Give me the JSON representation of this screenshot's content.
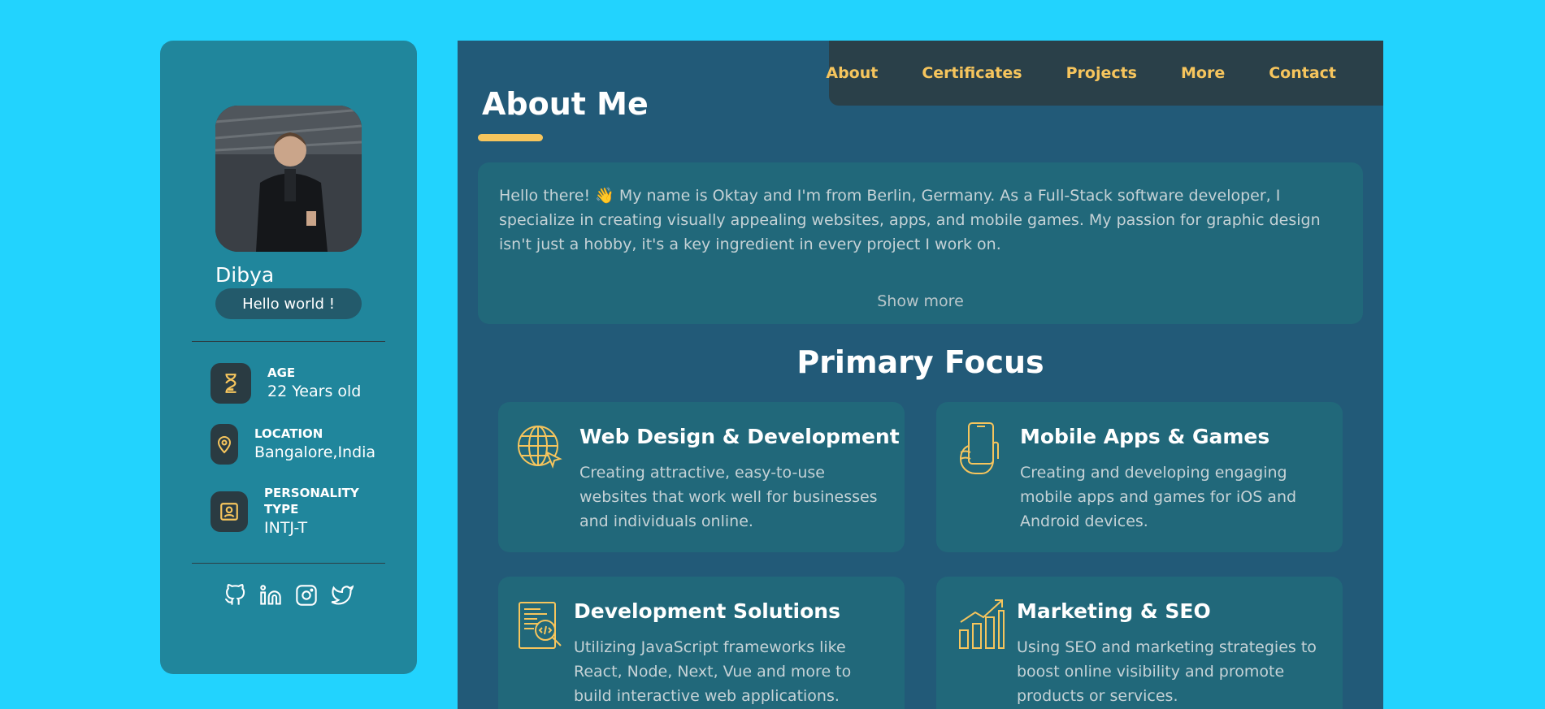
{
  "profile": {
    "name": "Dibya",
    "tagline": "Hello world !",
    "info": [
      {
        "label": "AGE",
        "value": "22 Years old",
        "icon": "hourglass-icon"
      },
      {
        "label": "LOCATION",
        "value": "Bangalore,India",
        "icon": "location-pin-icon"
      },
      {
        "label": "PERSONALITY TYPE",
        "value": "INTJ-T",
        "icon": "contact-card-icon"
      }
    ],
    "social": [
      "github-icon",
      "linkedin-icon",
      "instagram-icon",
      "twitter-icon"
    ]
  },
  "nav": {
    "items": [
      "About",
      "Certificates",
      "Projects",
      "More",
      "Contact"
    ]
  },
  "about": {
    "title": "About Me",
    "text": "Hello there! 👋 My name is Oktay and I'm from Berlin, Germany. As a Full-Stack software developer, I specialize in creating visually appealing websites, apps, and mobile games. My passion for graphic design isn't just a hobby, it's a key ingredient in every project I work on.",
    "show_more": "Show more"
  },
  "focus": {
    "title": "Primary Focus",
    "cards": [
      {
        "title": "Web Design & Development",
        "desc": "Creating attractive, easy-to-use websites that work well for businesses and individuals online.",
        "icon": "globe-cursor-icon"
      },
      {
        "title": "Mobile Apps & Games",
        "desc": "Creating and developing engaging mobile apps and games for iOS and Android devices.",
        "icon": "phone-hand-icon"
      },
      {
        "title": "Development Solutions",
        "desc": "Utilizing JavaScript frameworks like React, Node, Next, Vue and more to build interactive web applications.",
        "icon": "code-search-icon"
      },
      {
        "title": "Marketing & SEO",
        "desc": "Using SEO and marketing strategies to boost online visibility and promote products or services.",
        "icon": "growth-chart-icon"
      }
    ]
  },
  "colors": {
    "page_bg": "#22d3fe",
    "sidebar_bg": "#20869c",
    "main_bg": "#225a78",
    "accent": "#f6c55d",
    "card_bg": "#21687a"
  }
}
